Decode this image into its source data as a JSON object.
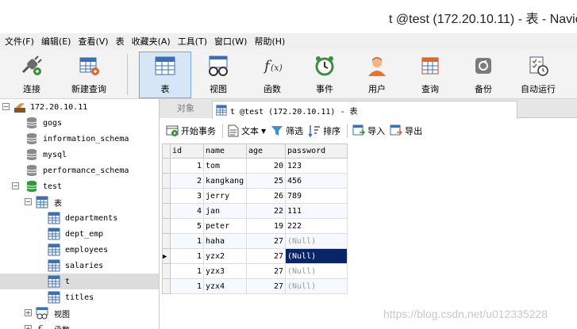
{
  "window": {
    "title": "t @test (172.20.10.11) - 表 - Navic"
  },
  "menu": [
    "文件(F)",
    "编辑(E)",
    "查看(V)",
    "表",
    "收藏夹(A)",
    "工具(T)",
    "窗口(W)",
    "帮助(H)"
  ],
  "toolbar": {
    "connect": "连接",
    "new_query": "新建查询",
    "table": "表",
    "view": "视图",
    "function": "函数",
    "event": "事件",
    "user": "用户",
    "query": "查询",
    "backup": "备份",
    "automation": "自动运行"
  },
  "tree": {
    "connection": "172.20.10.11",
    "databases": [
      "gogs",
      "information_schema",
      "mysql",
      "performance_schema",
      "test"
    ],
    "tables_folder": "表",
    "tables": [
      "departments",
      "dept_emp",
      "employees",
      "salaries",
      "t",
      "titles"
    ],
    "views_folder": "视图",
    "functions_folder": "函数"
  },
  "tabs": {
    "objects": "对象",
    "doc": "t @test (172.20.10.11) - 表"
  },
  "subtoolbar": {
    "begin_txn": "开始事务",
    "text": "文本",
    "filter": "筛选",
    "sort": "排序",
    "import": "导入",
    "export": "导出"
  },
  "grid": {
    "columns": [
      "id",
      "name",
      "age",
      "password"
    ],
    "rows": [
      [
        "1",
        "tom",
        "20",
        "123"
      ],
      [
        "2",
        "kangkang",
        "25",
        "456"
      ],
      [
        "3",
        "jerry",
        "26",
        "789"
      ],
      [
        "4",
        "jan",
        "22",
        "111"
      ],
      [
        "5",
        "peter",
        "19",
        "222"
      ],
      [
        "1",
        "haha",
        "27",
        "(Null)"
      ],
      [
        "1",
        "yzx2",
        "27",
        "(Null)"
      ],
      [
        "1",
        "yzx3",
        "27",
        "(Null)"
      ],
      [
        "1",
        "yzx4",
        "27",
        "(Null)"
      ]
    ]
  },
  "watermark": "https://blog.csdn.net/u012335228"
}
